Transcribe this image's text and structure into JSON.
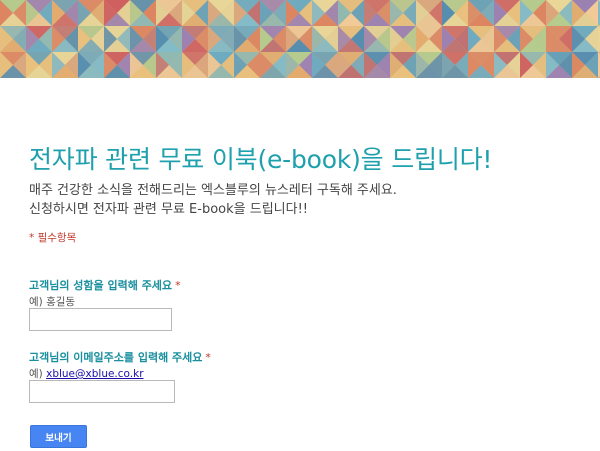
{
  "banner": {
    "colors": [
      "#e8b96a",
      "#d9744a",
      "#c94b4b",
      "#7fb0a8",
      "#5a9fb8",
      "#3d7ea6",
      "#e6d28a",
      "#a9c77f",
      "#8e6fa8",
      "#f0c48a",
      "#4f95b0",
      "#d89a6a",
      "#b85e5e",
      "#6fb3c2",
      "#e0a15a"
    ]
  },
  "form": {
    "title": "전자파 관련 무료 이북(e-book)을 드립니다!",
    "description_line1": "매주 건강한 소식을 전해드리는 엑스블루의 뉴스레터 구독해 주세요.",
    "description_line2": "신청하시면 전자파 관련 무료 E-book을 드립니다!!",
    "required_note": "* 필수항목",
    "questions": [
      {
        "label": "고객님의 성함을 입력해 주세요",
        "required_mark": "*",
        "hint": "예) 홍길동",
        "value": ""
      },
      {
        "label": "고객님의 이메일주소를 입력해 주세요",
        "required_mark": "*",
        "hint_prefix": "예)",
        "hint_link": "xblue@xblue.co.kr",
        "value": ""
      }
    ],
    "submit_label": "보내기"
  },
  "colors": {
    "title": "#1ea0ad",
    "question_label": "#1a8f9e",
    "required": "#c0392b",
    "submit_button": "#4786f2"
  }
}
